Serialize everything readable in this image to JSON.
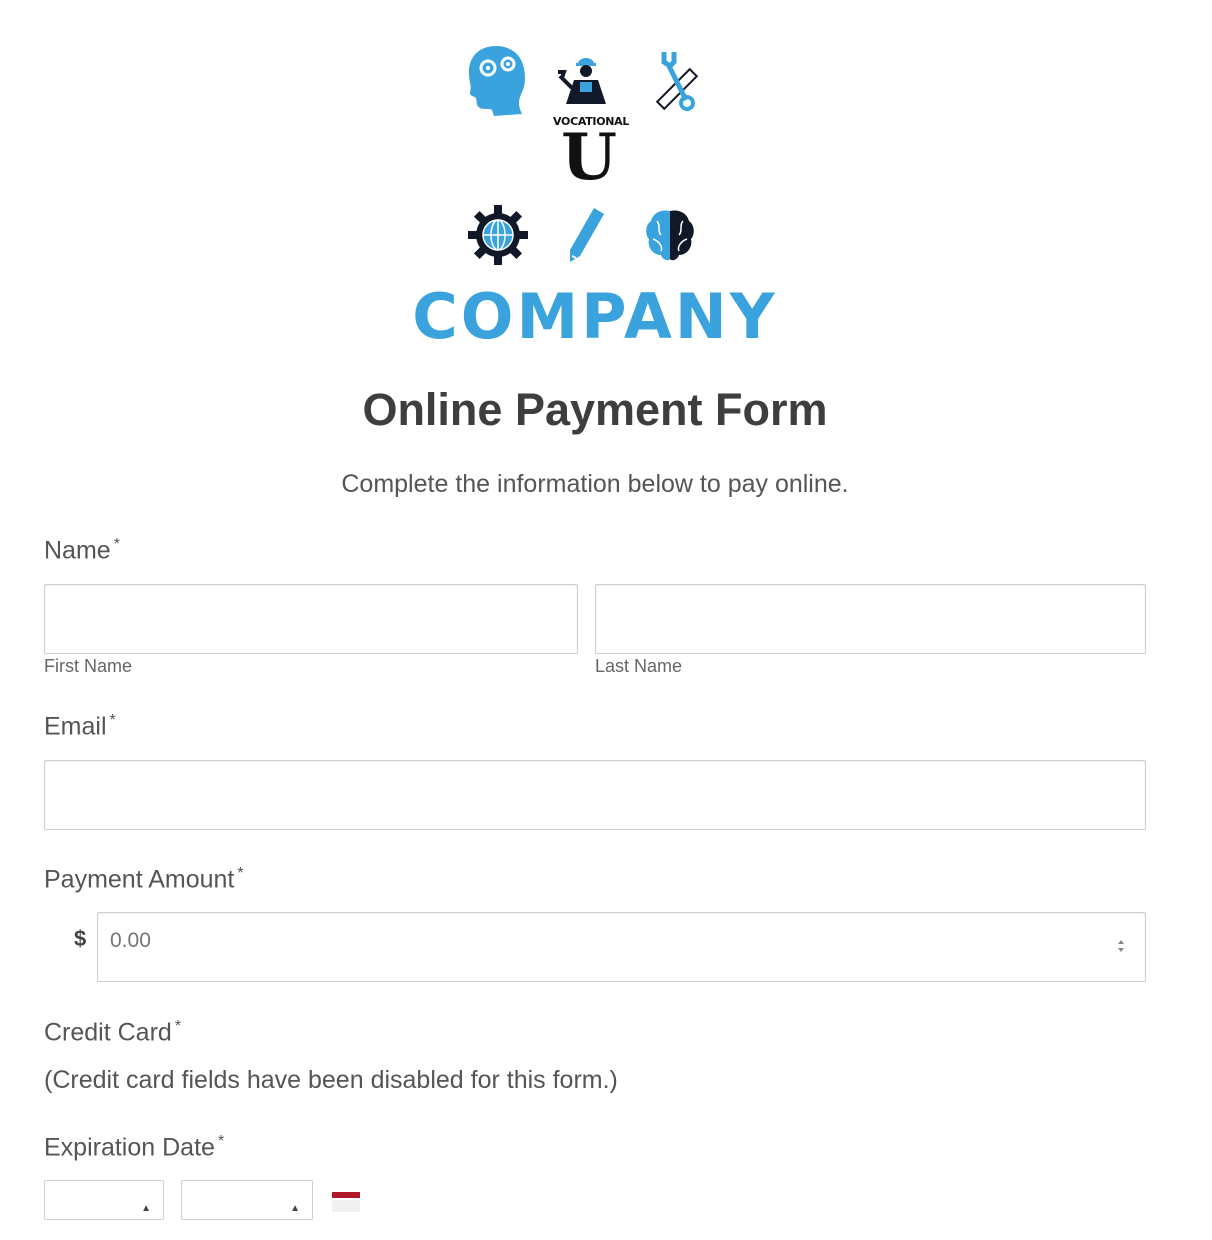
{
  "logo": {
    "vocational_text": "VOCATIONAL",
    "u_letter": "U",
    "company_name": "COMPANY",
    "icons": [
      "head-gears-icon",
      "worker-icon",
      "wrench-ruler-icon",
      "gear-globe-icon",
      "pencil-icon",
      "brain-icon"
    ],
    "accent_color": "#3aa3dd",
    "dark_color": "#111827"
  },
  "form": {
    "title": "Online Payment Form",
    "description": "Complete the information below to pay online.",
    "name": {
      "label": "Name",
      "required_mark": "*",
      "first_name": {
        "value": "",
        "sublabel": "First Name"
      },
      "last_name": {
        "value": "",
        "sublabel": "Last Name"
      }
    },
    "email": {
      "label": "Email",
      "required_mark": "*",
      "value": ""
    },
    "payment_amount": {
      "label": "Payment Amount",
      "required_mark": "*",
      "currency_symbol": "$",
      "placeholder": "0.00",
      "value": ""
    },
    "credit_card": {
      "label": "Credit Card",
      "required_mark": "*",
      "note": "(Credit card fields have been disabled for this form.)"
    },
    "expiration_date": {
      "label": "Expiration Date",
      "required_mark": "*",
      "month_value": "",
      "year_value": ""
    }
  }
}
